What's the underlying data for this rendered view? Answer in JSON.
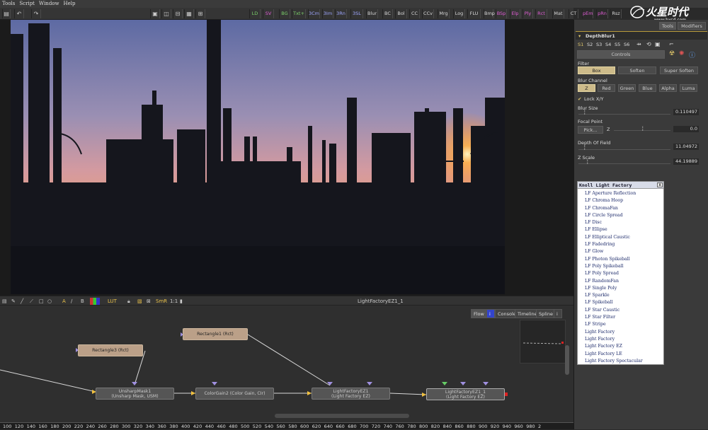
{
  "menubar": {
    "items": [
      "Tools",
      "Script",
      "Window",
      "Help"
    ]
  },
  "toolbar": {
    "buttons": [
      {
        "label": "LD",
        "color": "green"
      },
      {
        "label": "SV",
        "color": "magenta"
      },
      {
        "label": "BG",
        "color": "green"
      },
      {
        "label": "Txt+",
        "color": "green"
      },
      {
        "label": "3Cm",
        "color": "lt"
      },
      {
        "label": "3Im",
        "color": "lt"
      },
      {
        "label": "3Rn",
        "color": "lt"
      },
      {
        "label": "3SL",
        "color": "lt"
      },
      {
        "label": "Blur",
        "color": "white"
      },
      {
        "label": "BC",
        "color": "white"
      },
      {
        "label": "Bol",
        "color": "white"
      },
      {
        "label": "CC",
        "color": "white"
      },
      {
        "label": "CCv",
        "color": "white"
      },
      {
        "label": "Mrg",
        "color": "white"
      },
      {
        "label": "Log",
        "color": "white"
      },
      {
        "label": "FLU",
        "color": "white"
      },
      {
        "label": "Bmp",
        "color": "white"
      },
      {
        "label": "BSp",
        "color": "magenta"
      },
      {
        "label": "Elp",
        "color": "magenta"
      },
      {
        "label": "Ply",
        "color": "magenta"
      },
      {
        "label": "Rct",
        "color": "magenta"
      },
      {
        "label": "Mat",
        "color": "white"
      },
      {
        "label": "CT",
        "color": "white"
      },
      {
        "label": "pEm",
        "color": "magenta"
      },
      {
        "label": "pRn",
        "color": "magenta"
      },
      {
        "label": "Rsz",
        "color": "white"
      }
    ]
  },
  "logo": {
    "text": "火星时代",
    "url": "www.hxsd.com"
  },
  "viewer": {
    "title": "LightFactoryEZ1_1",
    "zoom": "1:1",
    "lut": "LUT",
    "smr": "SmR",
    "channel_labels": [
      "A",
      "B"
    ]
  },
  "flow_tabs": [
    "Flow",
    "Console",
    "Timeline",
    "Spline"
  ],
  "nodes": [
    {
      "line1": "Rectangle1  (Rct)",
      "line2": ""
    },
    {
      "line1": "Rectangle3  (Rct)",
      "line2": ""
    },
    {
      "line1": "UnsharpMask1",
      "line2": "(Unsharp Mask, USM)"
    },
    {
      "line1": "ColorGain2  (Color Gain, CIr)",
      "line2": ""
    },
    {
      "line1": "LightFactoryEZ1",
      "line2": "(Light Factory EZ)"
    },
    {
      "line1": "LightFactoryEZ1_1",
      "line2": "(Light Factory EZ)"
    }
  ],
  "ruler": {
    "ticks": [
      "100",
      "120",
      "140",
      "160",
      "180",
      "200",
      "220",
      "240",
      "260",
      "280",
      "300",
      "320",
      "340",
      "360",
      "380",
      "400",
      "420",
      "440",
      "460",
      "480",
      "500",
      "520",
      "540",
      "560",
      "580",
      "600",
      "620",
      "640",
      "660",
      "680",
      "700",
      "720",
      "740",
      "760",
      "780",
      "800",
      "820",
      "840",
      "860",
      "880",
      "900",
      "920",
      "940",
      "960",
      "980",
      "2"
    ]
  },
  "panel": {
    "tabs": [
      "Tools",
      "Modifiers"
    ],
    "tool_name": "DepthBlur1",
    "subtabs": [
      "S1",
      "S2",
      "S3",
      "S4",
      "S5",
      "S6"
    ],
    "controls_label": "Controls",
    "filter_label": "Filter",
    "filter_options": [
      "Box",
      "Soften",
      "Super Soften"
    ],
    "blur_channel_label": "Blur Channel",
    "blur_channels": [
      "Z",
      "Red",
      "Green",
      "Blue",
      "Alpha",
      "Luma"
    ],
    "lock_label": "Lock X/Y",
    "blur_size": {
      "label": "Blur Size",
      "value": "0.110497"
    },
    "focal_point": {
      "label": "Focal Point",
      "pick": "Pick...",
      "axis": "Z",
      "value": "0.0"
    },
    "depth_of_field": {
      "label": "Depth Of Field",
      "value": "11.04972"
    },
    "z_scale": {
      "label": "Z Scale",
      "value": "44.19889"
    }
  },
  "knoll": {
    "title": "Knoll Light Factory",
    "close": "x",
    "items": [
      "LF Aperture Reflection",
      "LF Chroma Hoop",
      "LF ChromaFan",
      "LF Circle Spread",
      "LF Disc",
      "LF Ellipse",
      "LF Elliptical Caustic",
      "LF Fadedring",
      "LF Glow",
      "LF Photon Spikeball",
      "LF Poly Spikeball",
      "LF Poly Spread",
      "LF RandomFan",
      "LF Single Poly",
      "LF Sparkle",
      "LF Spikeball",
      "LF Star Caustic",
      "LF Star Filter",
      "LF Stripe",
      "Light Factory",
      "Light Factory",
      "Light Factory EZ",
      "Light Factory LE",
      "Light Factory Spectacular"
    ]
  }
}
